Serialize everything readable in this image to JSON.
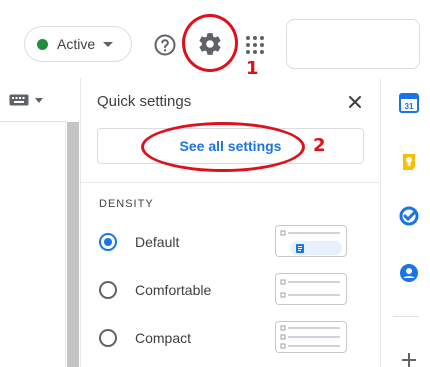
{
  "header": {
    "status_label": "Active",
    "status_color": "#1e8e3e",
    "icons": [
      "help-icon",
      "gear-icon",
      "apps-grid-icon"
    ]
  },
  "annotations": {
    "settings_marker": "1",
    "see_all_marker": "2",
    "color": "#e0101b"
  },
  "quick_settings": {
    "title": "Quick settings",
    "see_all_label": "See all settings",
    "density_heading": "DENSITY",
    "density_options": [
      {
        "label": "Default",
        "selected": true
      },
      {
        "label": "Comfortable",
        "selected": false
      },
      {
        "label": "Compact",
        "selected": false
      }
    ]
  },
  "side_panel": {
    "calendar_day": "31",
    "apps": [
      "calendar-icon",
      "keep-icon",
      "tasks-icon",
      "contacts-icon",
      "add-icon"
    ]
  },
  "colors": {
    "accent": "#1a73e8",
    "scrollbar": "#c4c4c4"
  }
}
